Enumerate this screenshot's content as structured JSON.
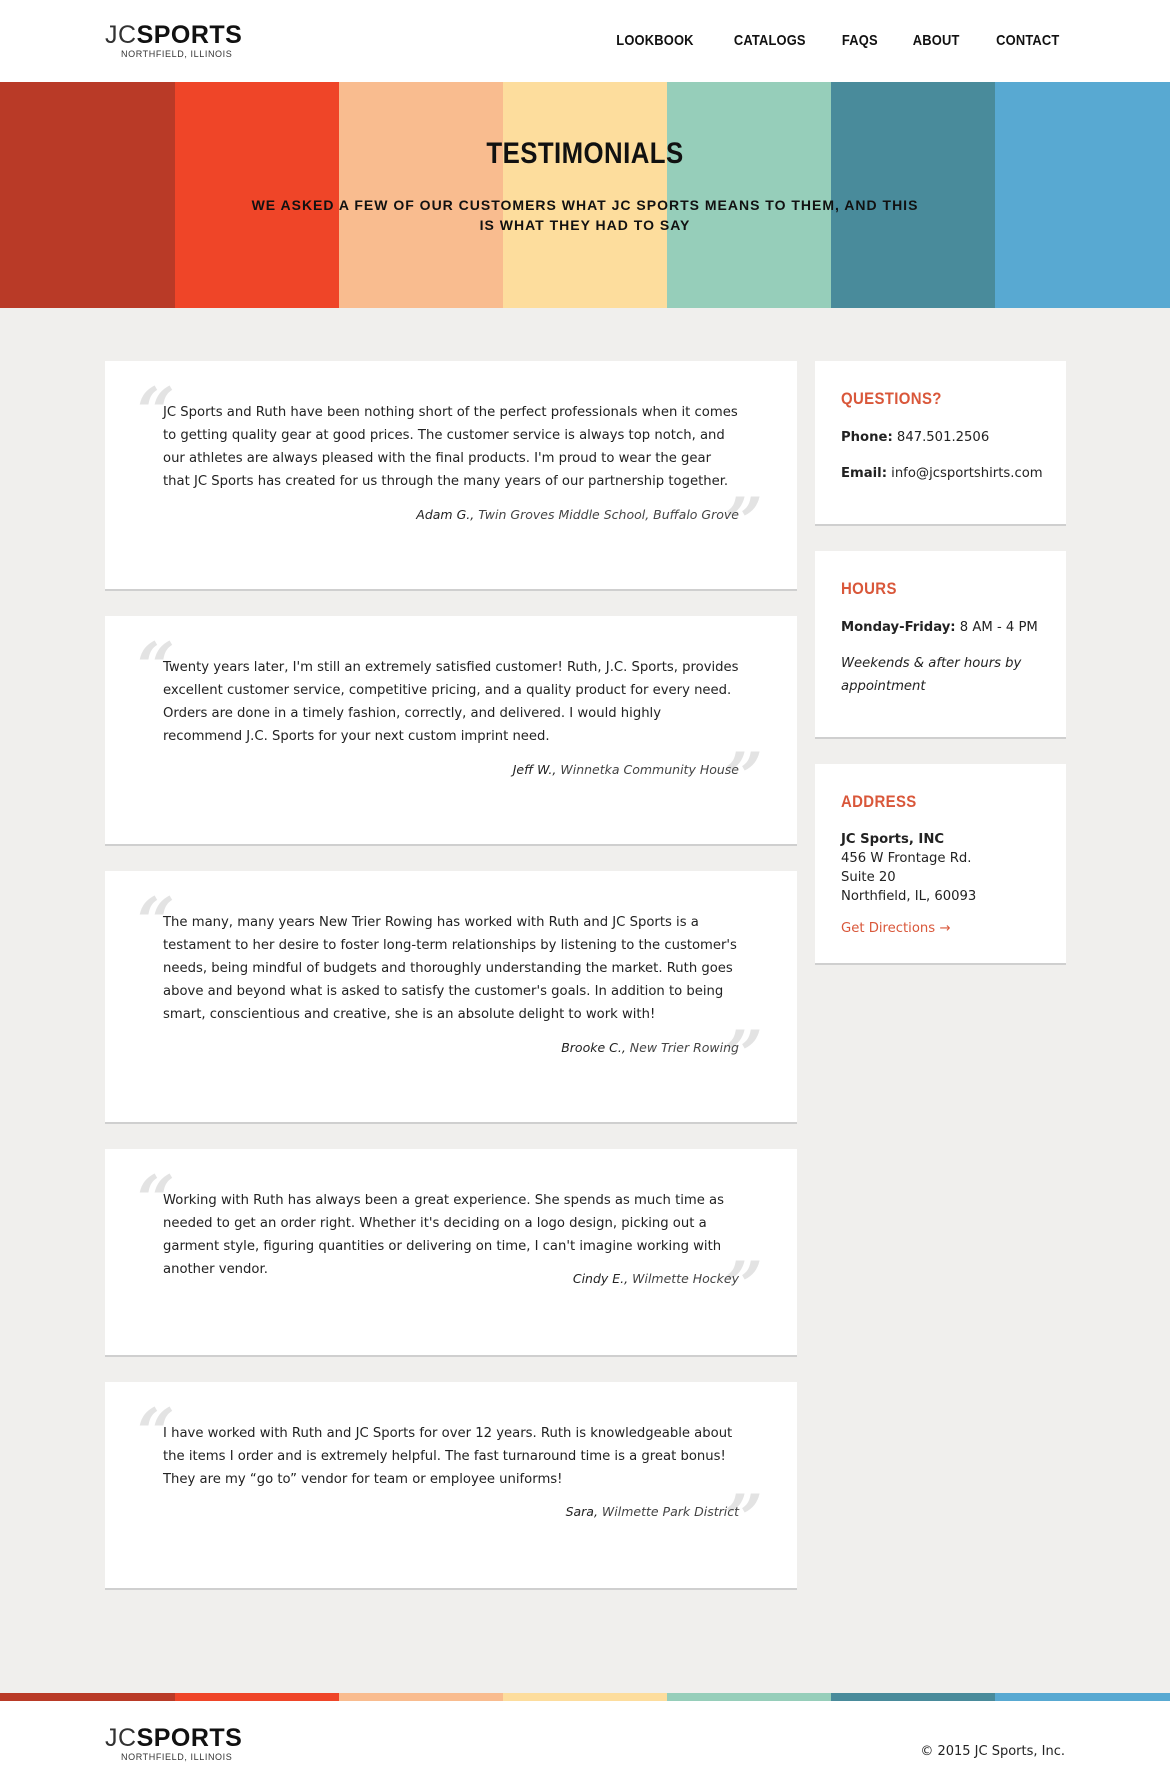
{
  "brand": {
    "name_light": "JC",
    "name_bold": "SPORTS",
    "location": "NORTHFIELD, ILLINOIS"
  },
  "nav": {
    "items": [
      "LOOKBOOK",
      "CATALOGS",
      "FAQS",
      "ABOUT",
      "CONTACT"
    ]
  },
  "hero": {
    "title": "TESTIMONIALS",
    "subtitle": "WE ASKED A FEW OF OUR CUSTOMERS WHAT JC SPORTS MEANS TO THEM, AND THIS IS WHAT THEY HAD TO SAY",
    "stripe_colors": [
      "#b93a27",
      "#ef4528",
      "#f9bc8f",
      "#fddd9d",
      "#96ceba",
      "#498b9b",
      "#58a9d2"
    ]
  },
  "testimonials": [
    {
      "text": "JC Sports and Ruth have been nothing short of the perfect professionals when it comes to getting quality gear at good prices. The customer service is always top notch, and our athletes are always pleased with the final products. I'm proud to wear the gear that JC Sports has created for us through the many years of our partnership together.",
      "name": "Adam G.,",
      "org": " Twin Groves Middle School, Buffalo Grove"
    },
    {
      "text": "Twenty years later, I'm still an extremely satisfied customer! Ruth, J.C. Sports, provides excellent customer service, competitive pricing, and a quality product for every need. Orders are done in a timely fashion, correctly, and delivered. I would highly recommend J.C. Sports for your next custom imprint need.",
      "name": "Jeff W.,",
      "org": " Winnetka Community House"
    },
    {
      "text": "The many, many years New Trier Rowing has worked with Ruth and JC Sports is a testament to her desire to foster long-term relationships by listening to the customer's needs, being mindful of budgets and thoroughly understanding the market. Ruth goes above and beyond what is asked to satisfy the customer's goals. In addition to being smart, conscientious and creative, she is an absolute delight to work with!",
      "name": "Brooke C.,",
      "org": " New Trier Rowing"
    },
    {
      "text": "Working with Ruth has always been a great experience. She spends as much time as needed to get an order right. Whether it's deciding on a logo design, picking out a garment style, figuring quantities or delivering on time, I can't imagine working with another vendor.",
      "name": "Cindy E.,",
      "org": " Wilmette Hockey"
    },
    {
      "text": "I have worked with Ruth and JC Sports for over 12 years. Ruth is knowledgeable about the items I order and is extremely helpful. The fast turnaround time is a great bonus! They are my “go to” vendor for team or employee uniforms!",
      "name": "Sara,",
      "org": " Wilmette Park District"
    }
  ],
  "sidebar": {
    "questions": {
      "heading": "QUESTIONS?",
      "phone_label": "Phone:",
      "phone": " 847.501.2506",
      "email_label": "Email:",
      "email": " info@jcsportshirts.com"
    },
    "hours": {
      "heading": "HOURS",
      "days_label": "Monday-Friday:",
      "days_value": " 8 AM - 4 PM",
      "note": "Weekends & after hours by appointment"
    },
    "address": {
      "heading": "ADDRESS",
      "company": "JC Sports, INC",
      "line1": "456 W Frontage Rd.",
      "line2": "Suite 20",
      "line3": "Northfield, IL, 60093",
      "directions": "Get Directions →"
    }
  },
  "footer": {
    "copyright": "© 2015  JC Sports, Inc."
  },
  "colors": {
    "accent": "#d9573a",
    "background": "#f0efed"
  }
}
